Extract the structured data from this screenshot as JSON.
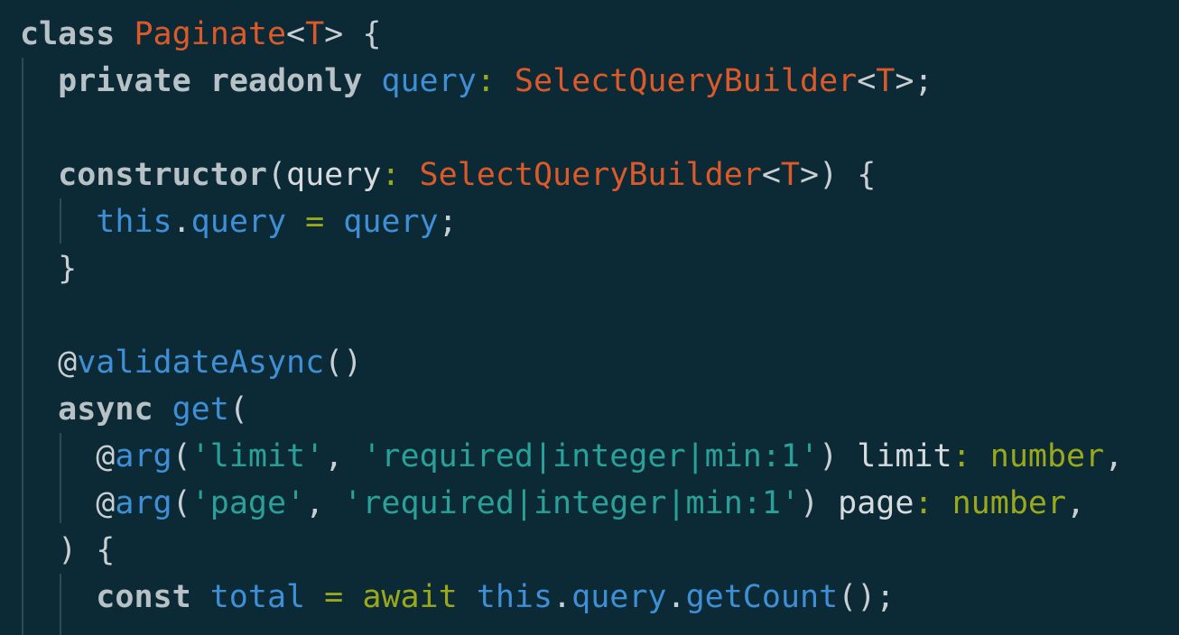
{
  "editor": {
    "language": "TypeScript",
    "colors": {
      "background": "#0c2a36",
      "keyword": "#b8c2c6",
      "class": "#dc5a2a",
      "property": "#3f8fd6",
      "string": "#2aa198",
      "type": "#9aa81b",
      "punctuation": "#c9ced3",
      "indent_guide": "#2f4a55"
    },
    "lines": [
      {
        "indent": 0,
        "tokens": [
          {
            "t": "class",
            "c": "kw"
          },
          {
            "t": " ",
            "c": "plain"
          },
          {
            "t": "Paginate",
            "c": "cls"
          },
          {
            "t": "<",
            "c": "pn"
          },
          {
            "t": "T",
            "c": "cls"
          },
          {
            "t": "> {",
            "c": "pn"
          }
        ]
      },
      {
        "indent": 1,
        "tokens": [
          {
            "t": "private",
            "c": "kw"
          },
          {
            "t": " ",
            "c": "plain"
          },
          {
            "t": "readonly",
            "c": "kw"
          },
          {
            "t": " ",
            "c": "plain"
          },
          {
            "t": "query",
            "c": "prop"
          },
          {
            "t": ": ",
            "c": "op"
          },
          {
            "t": "SelectQueryBuilder",
            "c": "cls"
          },
          {
            "t": "<",
            "c": "pn"
          },
          {
            "t": "T",
            "c": "cls"
          },
          {
            "t": ">;",
            "c": "pn"
          }
        ]
      },
      {
        "indent": 1,
        "tokens": []
      },
      {
        "indent": 1,
        "tokens": [
          {
            "t": "constructor",
            "c": "kw"
          },
          {
            "t": "(",
            "c": "pn"
          },
          {
            "t": "query",
            "c": "plain"
          },
          {
            "t": ": ",
            "c": "op"
          },
          {
            "t": "SelectQueryBuilder",
            "c": "cls"
          },
          {
            "t": "<",
            "c": "pn"
          },
          {
            "t": "T",
            "c": "cls"
          },
          {
            "t": ">) {",
            "c": "pn"
          }
        ]
      },
      {
        "indent": 2,
        "tokens": [
          {
            "t": "this",
            "c": "prop"
          },
          {
            "t": ".",
            "c": "pn"
          },
          {
            "t": "query",
            "c": "prop"
          },
          {
            "t": " = ",
            "c": "op"
          },
          {
            "t": "query",
            "c": "prop"
          },
          {
            "t": ";",
            "c": "pn"
          }
        ]
      },
      {
        "indent": 1,
        "tokens": [
          {
            "t": "}",
            "c": "pn"
          }
        ]
      },
      {
        "indent": 1,
        "tokens": []
      },
      {
        "indent": 1,
        "tokens": [
          {
            "t": "@",
            "c": "dec"
          },
          {
            "t": "validateAsync",
            "c": "fn"
          },
          {
            "t": "()",
            "c": "pn"
          }
        ]
      },
      {
        "indent": 1,
        "tokens": [
          {
            "t": "async",
            "c": "kw"
          },
          {
            "t": " ",
            "c": "plain"
          },
          {
            "t": "get",
            "c": "fn"
          },
          {
            "t": "(",
            "c": "pn"
          }
        ]
      },
      {
        "indent": 2,
        "tokens": [
          {
            "t": "@",
            "c": "dec"
          },
          {
            "t": "arg",
            "c": "fn"
          },
          {
            "t": "(",
            "c": "pn"
          },
          {
            "t": "'limit'",
            "c": "str"
          },
          {
            "t": ", ",
            "c": "pn"
          },
          {
            "t": "'required|integer|min:1'",
            "c": "str"
          },
          {
            "t": ") ",
            "c": "pn"
          },
          {
            "t": "limit",
            "c": "plain"
          },
          {
            "t": ": ",
            "c": "op"
          },
          {
            "t": "number",
            "c": "typ"
          },
          {
            "t": ",",
            "c": "pn"
          }
        ]
      },
      {
        "indent": 2,
        "tokens": [
          {
            "t": "@",
            "c": "dec"
          },
          {
            "t": "arg",
            "c": "fn"
          },
          {
            "t": "(",
            "c": "pn"
          },
          {
            "t": "'page'",
            "c": "str"
          },
          {
            "t": ", ",
            "c": "pn"
          },
          {
            "t": "'required|integer|min:1'",
            "c": "str"
          },
          {
            "t": ") ",
            "c": "pn"
          },
          {
            "t": "page",
            "c": "plain"
          },
          {
            "t": ": ",
            "c": "op"
          },
          {
            "t": "number",
            "c": "typ"
          },
          {
            "t": ",",
            "c": "pn"
          }
        ]
      },
      {
        "indent": 1,
        "tokens": [
          {
            "t": ") {",
            "c": "pn"
          }
        ]
      },
      {
        "indent": 2,
        "tokens": [
          {
            "t": "const",
            "c": "kw"
          },
          {
            "t": " ",
            "c": "plain"
          },
          {
            "t": "total",
            "c": "prop"
          },
          {
            "t": " = ",
            "c": "op"
          },
          {
            "t": "await",
            "c": "aw"
          },
          {
            "t": " ",
            "c": "plain"
          },
          {
            "t": "this",
            "c": "prop"
          },
          {
            "t": ".",
            "c": "pn"
          },
          {
            "t": "query",
            "c": "prop"
          },
          {
            "t": ".",
            "c": "pn"
          },
          {
            "t": "getCount",
            "c": "fn"
          },
          {
            "t": "();",
            "c": "pn"
          }
        ]
      }
    ]
  }
}
